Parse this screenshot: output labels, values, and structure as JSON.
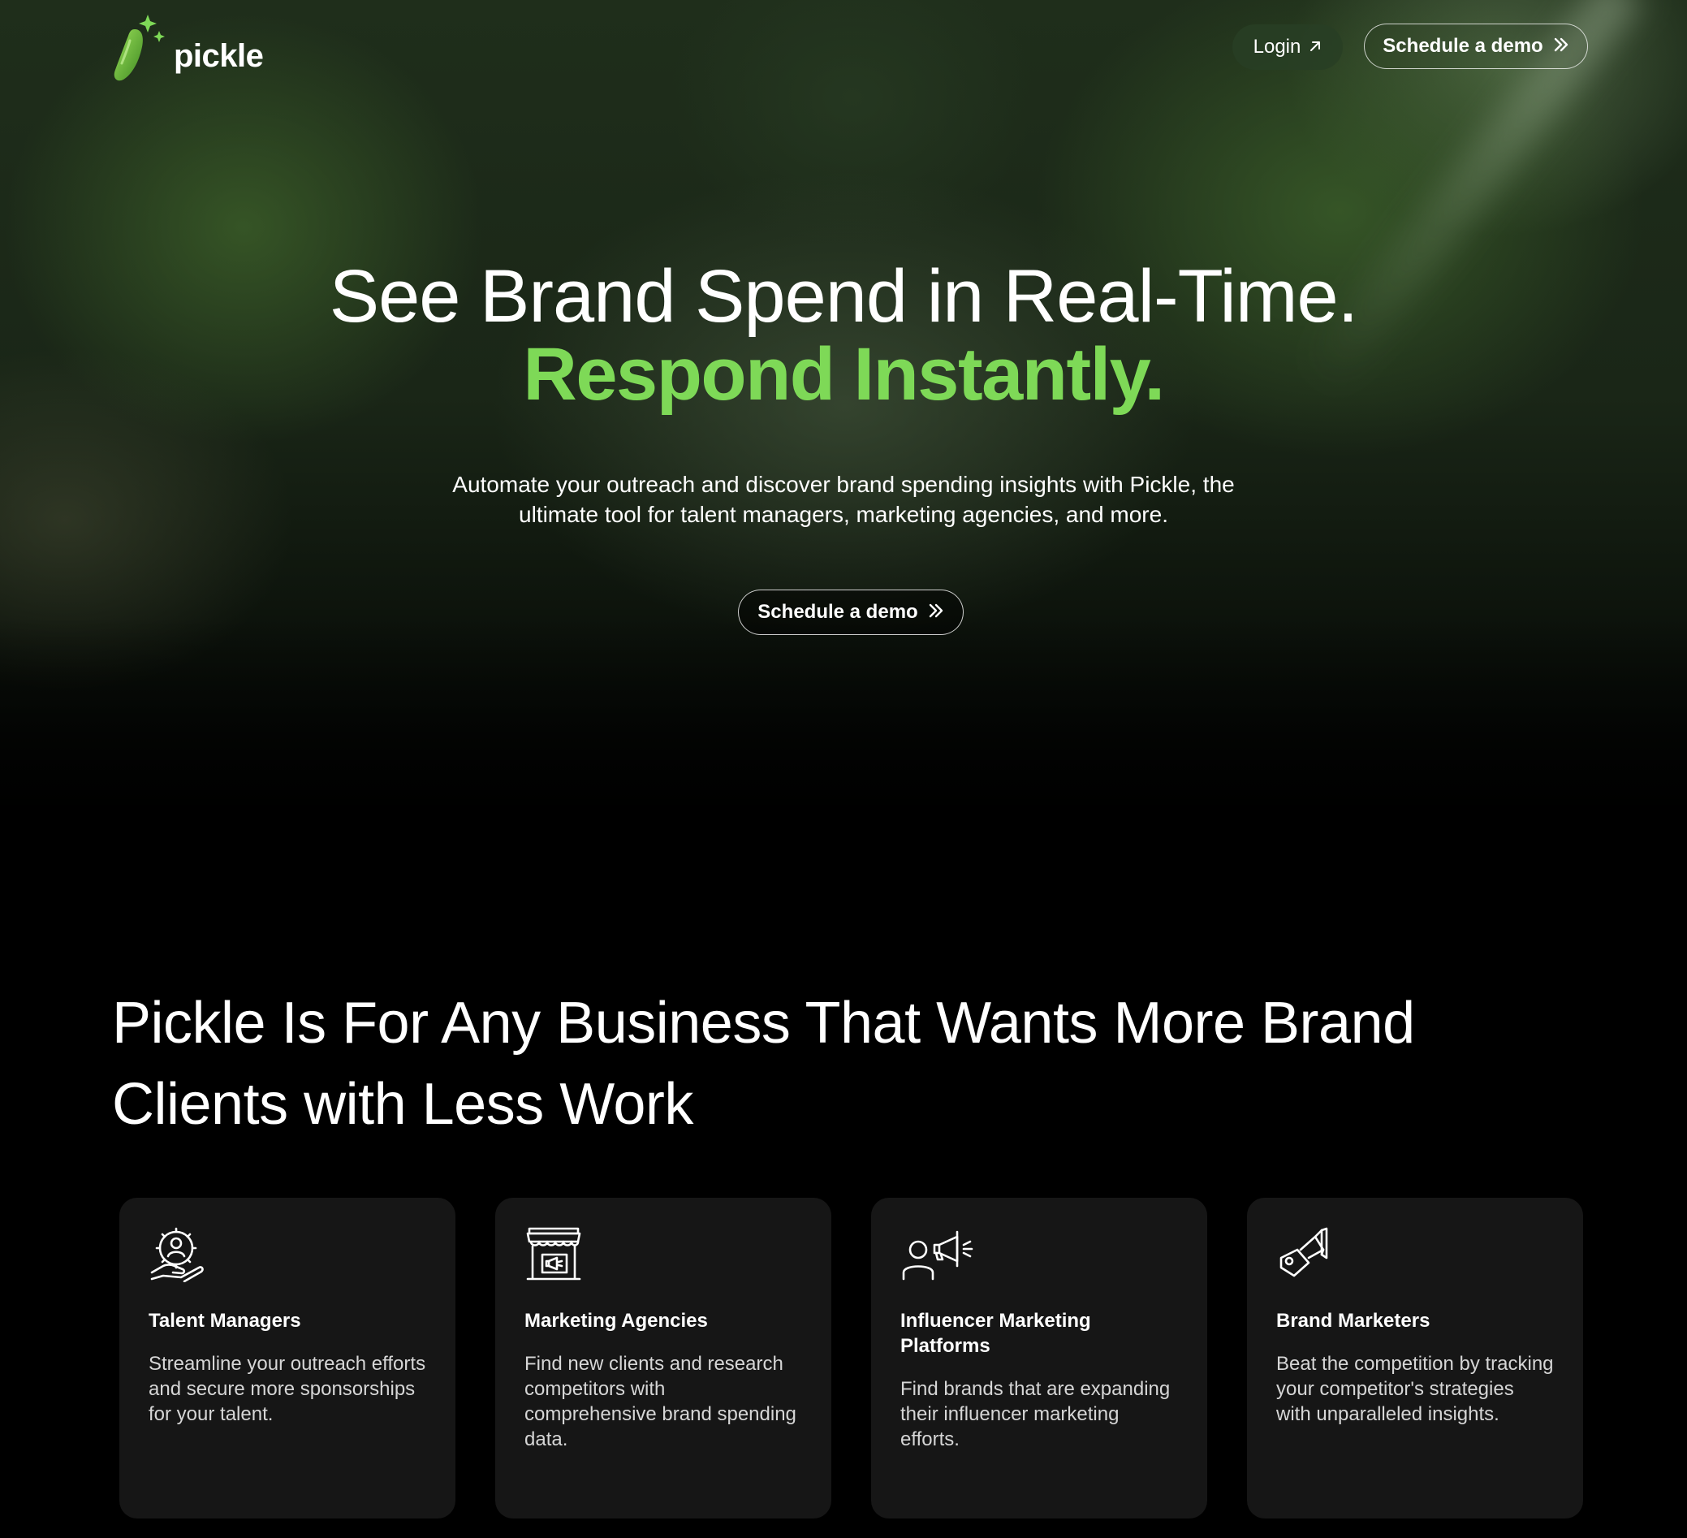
{
  "brand": {
    "name": "pickle",
    "accent_color": "#7ed957"
  },
  "nav": {
    "login_label": "Login",
    "login_icon": "arrow-up-right-icon",
    "demo_label": "Schedule a demo",
    "demo_icon": "double-chevron-right-icon"
  },
  "hero": {
    "headline_line1": "See Brand Spend in Real-Time.",
    "headline_line2": "Respond Instantly.",
    "subhead_line1": "Automate your outreach and discover brand spending insights with Pickle, the",
    "subhead_line2": "ultimate tool for talent managers, marketing agencies, and more.",
    "cta_label": "Schedule a demo",
    "cta_icon": "double-chevron-right-icon"
  },
  "section": {
    "title_line1": "Pickle Is For Any Business That Wants More Brand",
    "title_line2": "Clients with Less Work"
  },
  "cards": [
    {
      "icon": "talent-gear-hand-icon",
      "title": "Talent Managers",
      "description": "Streamline your outreach efforts and secure more sponsorships for your talent."
    },
    {
      "icon": "storefront-megaphone-icon",
      "title": "Marketing Agencies",
      "description": "Find new clients and research competitors with comprehensive brand spending data."
    },
    {
      "icon": "person-megaphone-icon",
      "title": "Influencer Marketing Platforms",
      "description": "Find brands that are expanding their influencer marketing efforts."
    },
    {
      "icon": "tag-megaphone-icon",
      "title": "Brand Marketers",
      "description": "Beat the competition by tracking your competitor's strategies with unparalleled insights."
    }
  ]
}
